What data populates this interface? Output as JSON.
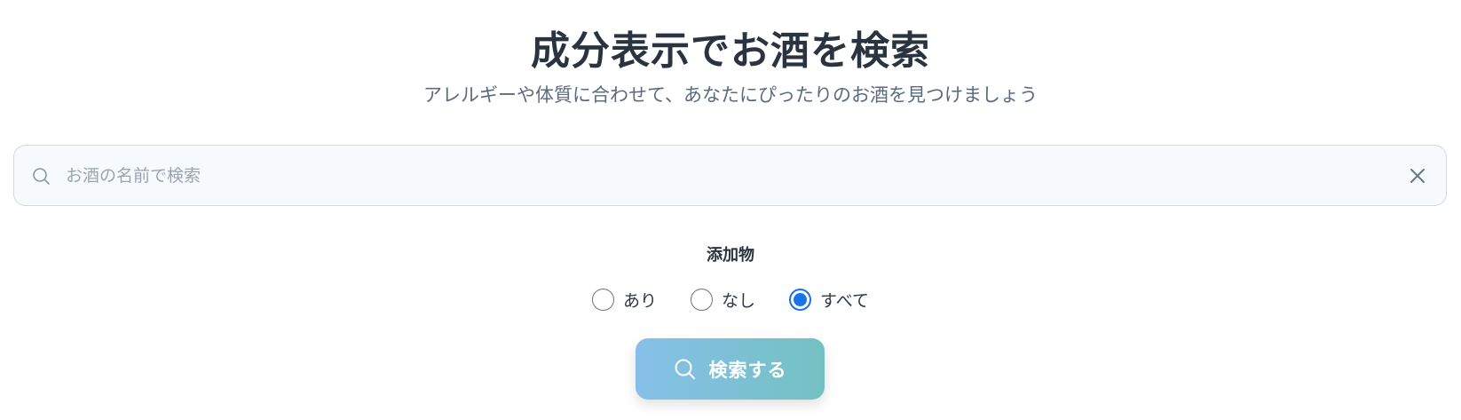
{
  "header": {
    "title": "成分表示でお酒を検索",
    "subtitle": "アレルギーや体質に合わせて、あなたにぴったりのお酒を見つけましょう"
  },
  "search": {
    "placeholder": "お酒の名前で検索",
    "value": "",
    "icon": "search-icon",
    "clear_icon": "close-icon"
  },
  "filter": {
    "label": "添加物",
    "options": [
      {
        "label": "あり",
        "checked": false
      },
      {
        "label": "なし",
        "checked": false
      },
      {
        "label": "すべて",
        "checked": true
      }
    ]
  },
  "submit": {
    "label": "検索する",
    "icon": "search-icon"
  },
  "colors": {
    "radio_checked": "#1a73e8",
    "button_gradient_start": "#86c0e9",
    "button_gradient_end": "#74c1c2",
    "title": "#2a3440",
    "subtitle": "#5a6b80"
  }
}
